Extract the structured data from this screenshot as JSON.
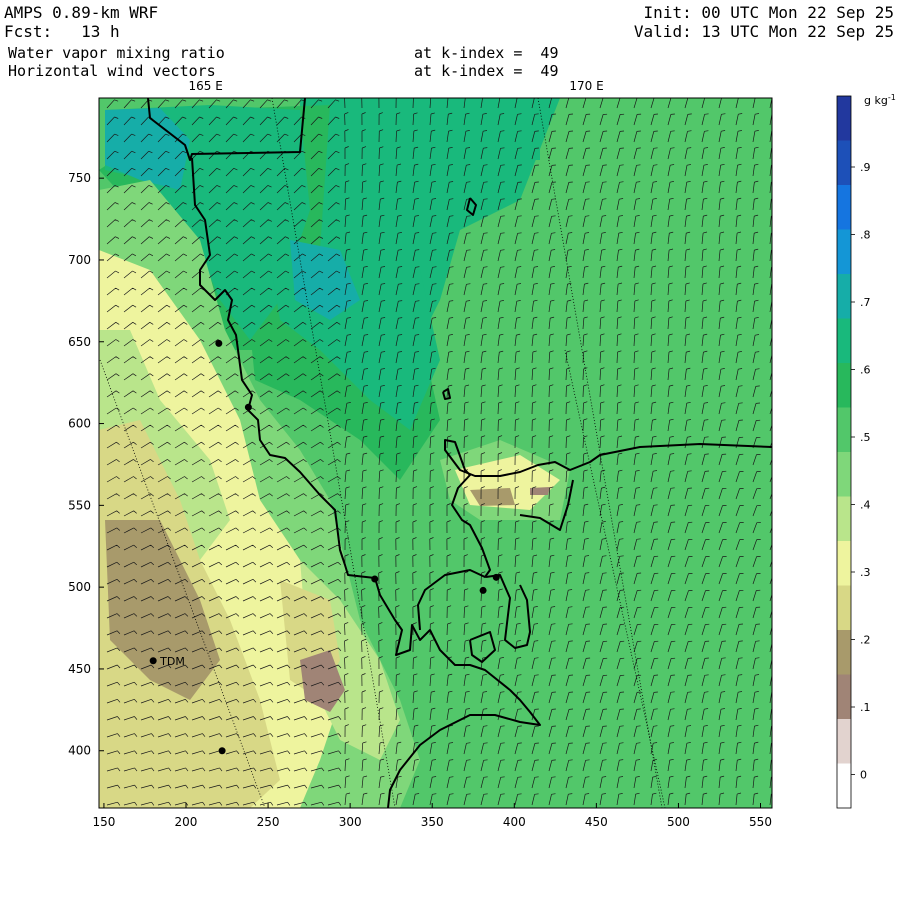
{
  "header": {
    "model": "AMPS 0.89-km WRF",
    "forecast": "Fcst:   13 h",
    "field1": "Water vapor mixing ratio",
    "field2": "Horizontal wind vectors",
    "k_index1": "at k-index =  49",
    "k_index2": "at k-index =  49",
    "init": "Init: 00 UTC Mon 22 Sep 25",
    "valid": "Valid: 13 UTC Mon 22 Sep 25"
  },
  "map": {
    "x_ticks": [
      150,
      200,
      250,
      300,
      350,
      400,
      450,
      500,
      550
    ],
    "y_ticks": [
      400,
      450,
      500,
      550,
      600,
      650,
      700,
      750
    ],
    "xlim": [
      147,
      557
    ],
    "ylim": [
      365,
      799
    ],
    "longitude_labels": [
      {
        "text": "165 E",
        "x": 212
      },
      {
        "text": "170 E",
        "x": 444
      }
    ],
    "station_label": "TDM",
    "stations": [
      {
        "x": 220,
        "y": 649
      },
      {
        "x": 238,
        "y": 610
      },
      {
        "x": 180,
        "y": 455
      },
      {
        "x": 222,
        "y": 400
      },
      {
        "x": 315,
        "y": 505
      },
      {
        "x": 381,
        "y": 498
      },
      {
        "x": 389,
        "y": 506
      }
    ]
  },
  "colorbar": {
    "unit": "g kg",
    "unit_exp": "-1",
    "labels": [
      ".9",
      ".8",
      ".7",
      ".6",
      ".5",
      ".4",
      ".3",
      ".2",
      ".1",
      "0"
    ],
    "colors": [
      "#ffffff",
      "#e2d3cf",
      "#a08476",
      "#a89a6b",
      "#d8d886",
      "#eef49e",
      "#b9e58b",
      "#7fd77a",
      "#52c76a",
      "#28b85c",
      "#19b97c",
      "#16ada8",
      "#1496d6",
      "#1575e0",
      "#1d50b8",
      "#22389e"
    ]
  }
}
